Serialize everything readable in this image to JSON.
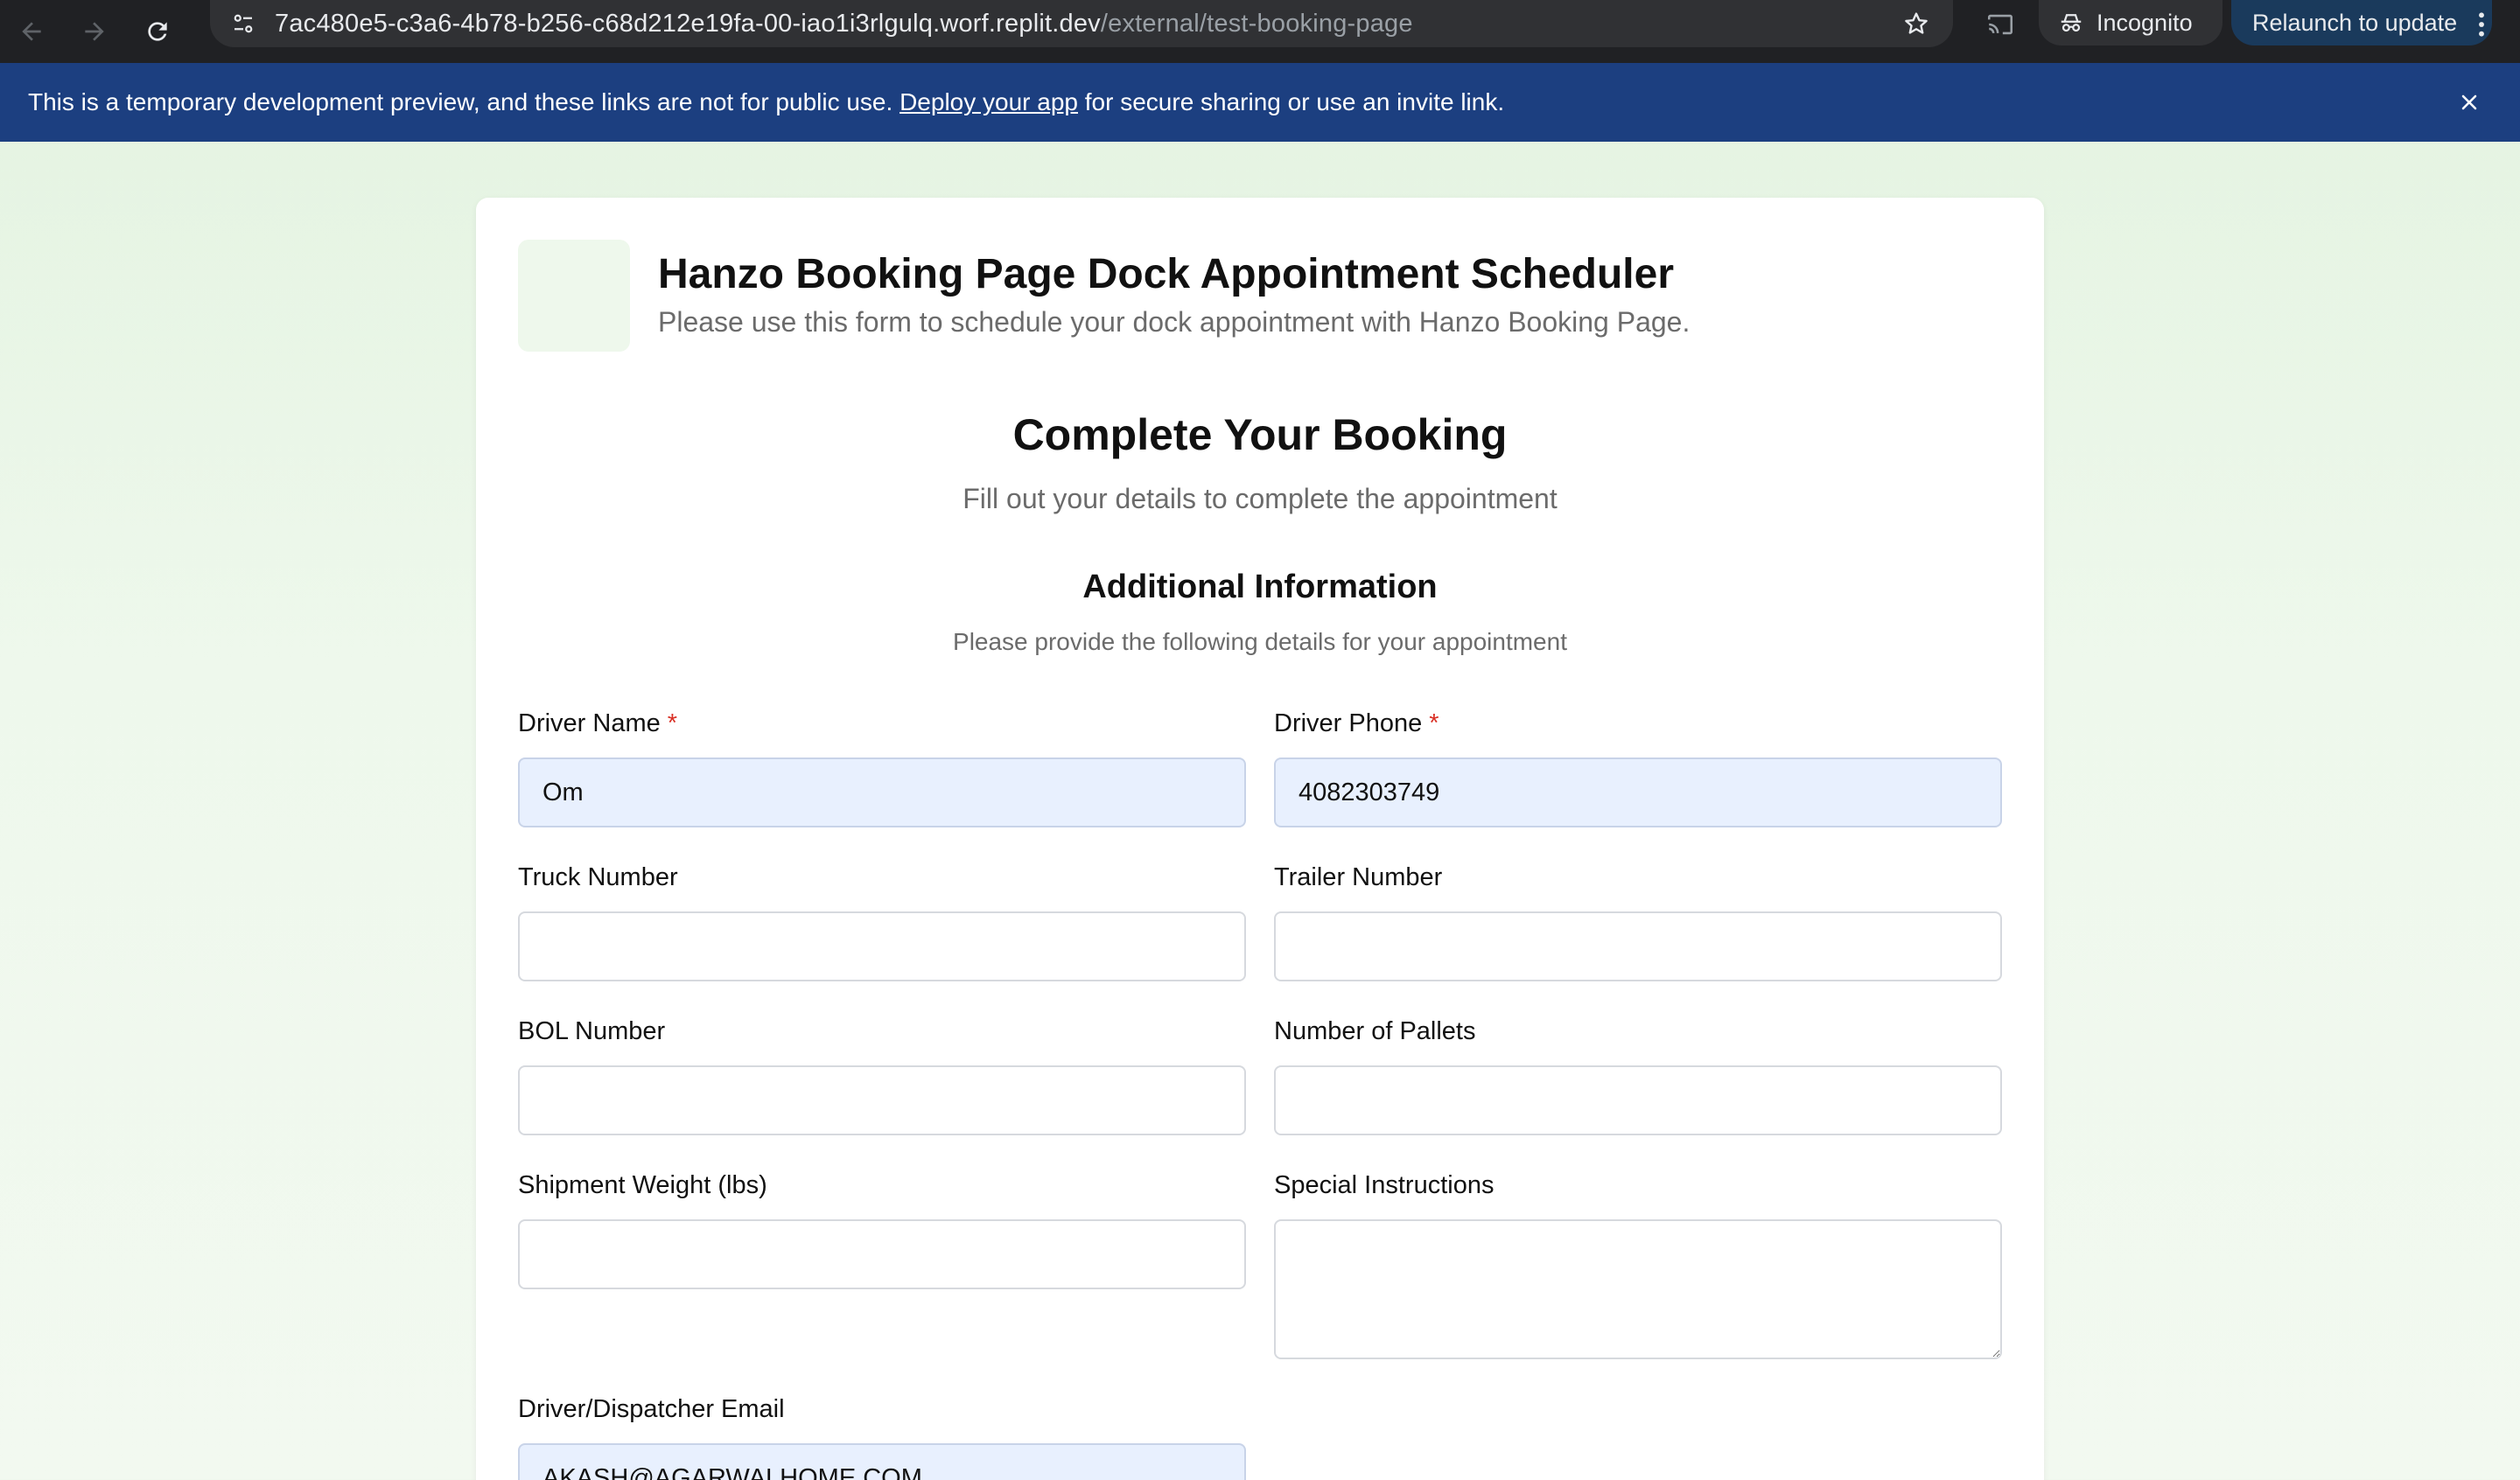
{
  "browser": {
    "url_host": "7ac480e5-c3a6-4b78-b256-c68d212e19fa-00-iao1i3rlgulq.worf.replit.dev",
    "url_path": "/external/test-booking-page",
    "incognito_label": "Incognito",
    "relaunch_label": "Relaunch to update"
  },
  "banner": {
    "text_before": "This is a temporary development preview, and these links are not for public use. ",
    "link_text": "Deploy your app",
    "text_after": " for secure sharing or use an invite link."
  },
  "header": {
    "title": "Hanzo Booking Page Dock Appointment Scheduler",
    "subtitle": "Please use this form to schedule your dock appointment with Hanzo Booking Page."
  },
  "booking": {
    "title": "Complete Your Booking",
    "subtitle": "Fill out your details to complete the appointment"
  },
  "additional": {
    "title": "Additional Information",
    "subtitle": "Please provide the following details for your appointment"
  },
  "form": {
    "driver_name": {
      "label": "Driver Name",
      "required_mark": "*",
      "value": "Om"
    },
    "driver_phone": {
      "label": "Driver Phone",
      "required_mark": "*",
      "value": "4082303749"
    },
    "truck_number": {
      "label": "Truck Number",
      "value": ""
    },
    "trailer_number": {
      "label": "Trailer Number",
      "value": ""
    },
    "bol_number": {
      "label": "BOL Number",
      "value": ""
    },
    "pallets": {
      "label": "Number of Pallets",
      "value": ""
    },
    "weight": {
      "label": "Shipment Weight (lbs)",
      "value": ""
    },
    "instructions": {
      "label": "Special Instructions",
      "value": ""
    },
    "email": {
      "label": "Driver/Dispatcher Email",
      "value": "AKASH@AGARWALHOME.COM"
    }
  },
  "colors": {
    "chrome": "#202124",
    "banner": "#1c3f80",
    "required": "#d93025",
    "autofill": "#e8f0fe",
    "page_bg": "#e3f3e0"
  }
}
